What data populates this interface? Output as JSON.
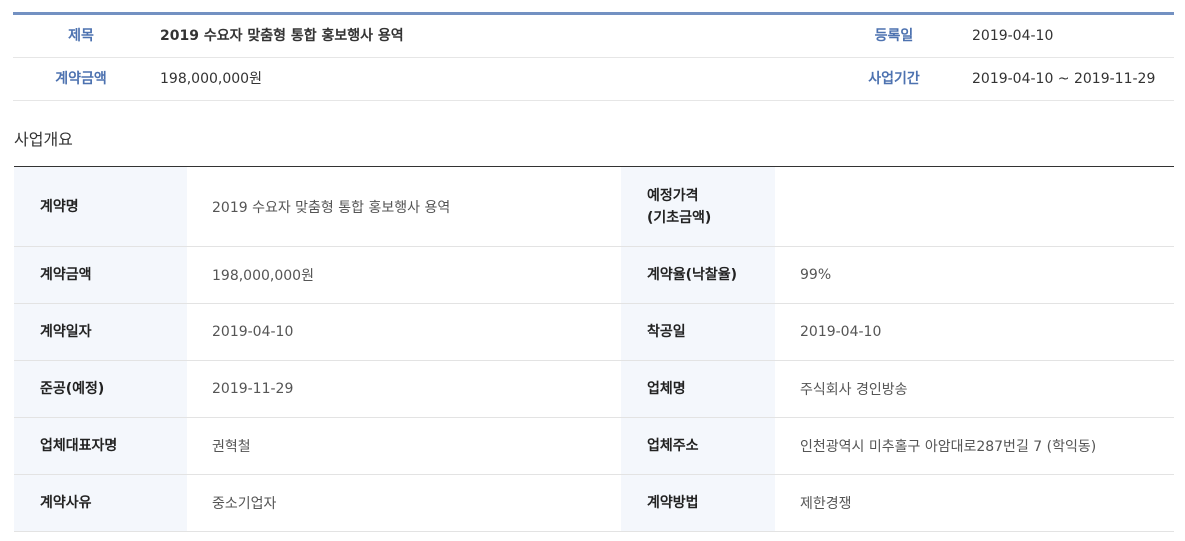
{
  "summary": {
    "title_label": "제목",
    "title_value": "2019 수요자 맞춤형 통합 홍보행사 용역",
    "reg_date_label": "등록일",
    "reg_date_value": "2019-04-10",
    "amount_label": "계약금액",
    "amount_value": "198,000,000원",
    "period_label": "사업기간",
    "period_value": "2019-04-10 ~ 2019-11-29"
  },
  "section": {
    "title": "사업개요"
  },
  "detail": {
    "rows": [
      {
        "h1": "계약명",
        "v1": "2019 수요자 맞춤형 통합 홍보행사 용역",
        "h2_line1": "예정가격",
        "h2_line2": "(기초금액)",
        "v2": ""
      },
      {
        "h1": "계약금액",
        "v1": "198,000,000원",
        "h2": "계약율(낙찰율)",
        "v2": "99%"
      },
      {
        "h1": "계약일자",
        "v1": "2019-04-10",
        "h2": "착공일",
        "v2": "2019-04-10"
      },
      {
        "h1": "준공(예정)",
        "v1": "2019-11-29",
        "h2": "업체명",
        "v2": "주식회사 경인방송"
      },
      {
        "h1": "업체대표자명",
        "v1": "권혁철",
        "h2": "업체주소",
        "v2": "인천광역시 미추홀구 아암대로287번길 7 (학익동)"
      },
      {
        "h1": "계약사유",
        "v1": "중소기업자",
        "h2": "계약방법",
        "v2": "제한경쟁"
      }
    ]
  }
}
